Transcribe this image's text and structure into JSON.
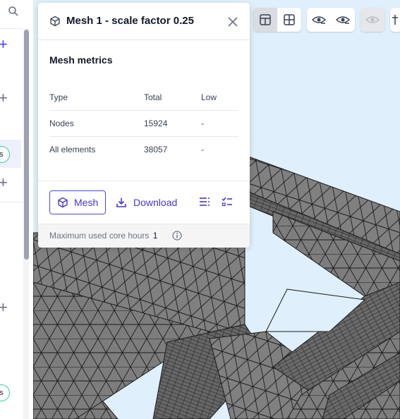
{
  "panel": {
    "title": "Mesh 1 - scale factor 0.25",
    "section_title": "Mesh metrics",
    "table": {
      "headers": [
        "Type",
        "Total",
        "Low"
      ],
      "rows": [
        [
          "Nodes",
          "15924",
          "-"
        ],
        [
          "All elements",
          "38057",
          "-"
        ]
      ]
    },
    "mesh_button_label": "Mesh",
    "download_button_label": "Download",
    "footer_label": "Maximum used core hours",
    "footer_value": "1"
  },
  "sidebar": {
    "badges": [
      "s",
      "s"
    ]
  },
  "toolbar": {
    "icons": [
      "split-view-icon",
      "grid-view-icon",
      "eye-hide-icon",
      "eye-show-icon",
      "eye-disabled-icon",
      "clip-icon"
    ]
  },
  "colors": {
    "accent": "#4f46e5",
    "viewport_bg": "#dfeffb",
    "mesh_fill": "#7a7a7a",
    "badge_border": "#34d399"
  }
}
